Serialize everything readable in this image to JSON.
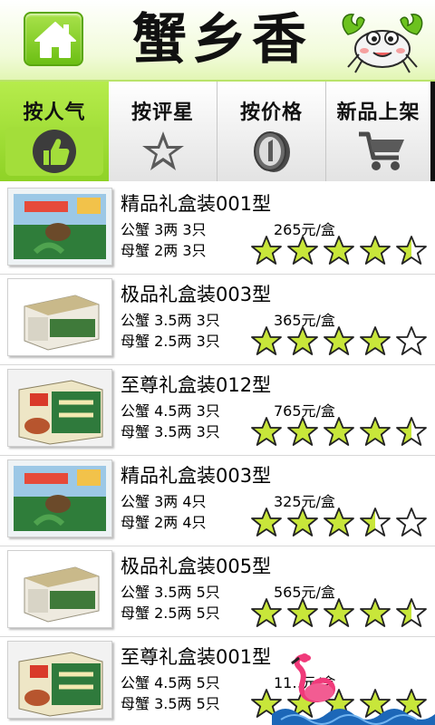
{
  "header": {
    "title": "蟹乡香",
    "home_icon": "home-icon",
    "logo_icon": "crab-logo-icon"
  },
  "tabs": [
    {
      "label": "按人气",
      "icon": "thumbs-up-icon",
      "active": true
    },
    {
      "label": "按评星",
      "icon": "star-icon",
      "active": false
    },
    {
      "label": "按价格",
      "icon": "coin-icon",
      "active": false
    },
    {
      "label": "新品上架",
      "icon": "cart-icon",
      "active": false
    }
  ],
  "products": [
    {
      "name": "精品礼盒装001型",
      "male": "公蟹 3两 3只",
      "female": "母蟹 2两 3只",
      "price": "265元/盒",
      "rating": 4.5,
      "box": "lake"
    },
    {
      "name": "极品礼盒装003型",
      "male": "公蟹 3.5两 3只",
      "female": "母蟹 2.5两 3只",
      "price": "365元/盒",
      "rating": 4,
      "box": "white"
    },
    {
      "name": "至尊礼盒装012型",
      "male": "公蟹 4.5两 3只",
      "female": "母蟹 3.5两 3只",
      "price": "765元/盒",
      "rating": 4.5,
      "box": "green"
    },
    {
      "name": "精品礼盒装003型",
      "male": "公蟹 3两 4只",
      "female": "母蟹 2两 4只",
      "price": "325元/盒",
      "rating": 3.5,
      "box": "lake"
    },
    {
      "name": "极品礼盒装005型",
      "male": "公蟹 3.5两 5只",
      "female": "母蟹 2.5两 5只",
      "price": "565元/盒",
      "rating": 4.5,
      "box": "white"
    },
    {
      "name": "至尊礼盒装001型",
      "male": "公蟹 4.5两 5只",
      "female": "母蟹 3.5两 5只",
      "price": "11‥元/盒",
      "rating": 5,
      "box": "green"
    }
  ],
  "colors": {
    "accent": "#8fd226",
    "star_fill": "#c8e63a",
    "star_stroke": "#222222"
  }
}
